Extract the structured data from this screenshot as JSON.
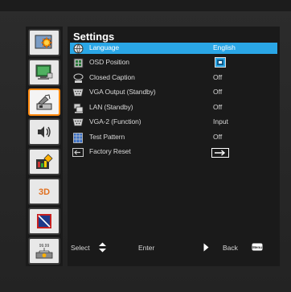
{
  "sidebar": {
    "items": [
      {
        "icon": "image-settings-icon",
        "active": false
      },
      {
        "icon": "display-icon",
        "active": false
      },
      {
        "icon": "setup-icon",
        "active": true
      },
      {
        "icon": "volume-icon",
        "active": false
      },
      {
        "icon": "options-icon",
        "active": false
      },
      {
        "icon": "3d-icon",
        "label": "3D",
        "active": false
      },
      {
        "icon": "crop-icon",
        "active": false
      },
      {
        "icon": "lan-network-icon",
        "active": false
      }
    ]
  },
  "panel": {
    "title": "Settings",
    "rows": [
      {
        "label": "Language",
        "value": "English",
        "icon": "globe-icon",
        "selected": true
      },
      {
        "label": "OSD Position",
        "value": "",
        "value_icon": "osd-position-icon",
        "icon": "osd-position-menu-icon",
        "selected": false
      },
      {
        "label": "Closed Caption",
        "value": "Off",
        "icon": "closed-caption-icon",
        "selected": false
      },
      {
        "label": "VGA Output (Standby)",
        "value": "Off",
        "icon": "vga-output-icon",
        "selected": false
      },
      {
        "label": "LAN (Standby)",
        "value": "Off",
        "icon": "lan-icon",
        "selected": false
      },
      {
        "label": "VGA-2 (Function)",
        "value": "Input",
        "icon": "vga-function-icon",
        "selected": false
      },
      {
        "label": "Test Pattern",
        "value": "Off",
        "icon": "test-pattern-icon",
        "selected": false
      },
      {
        "label": "Factory Reset",
        "value": "",
        "value_icon": "arrow-enter-icon",
        "icon": "factory-reset-icon",
        "selected": false
      }
    ]
  },
  "footer": {
    "select_label": "Select",
    "enter_label": "Enter",
    "back_label": "Back",
    "menu_key_label": "Menu"
  },
  "colors": {
    "highlight": "#2aa6e6",
    "active_border": "#ff8a10",
    "panel_bg": "#1a1a1a"
  }
}
